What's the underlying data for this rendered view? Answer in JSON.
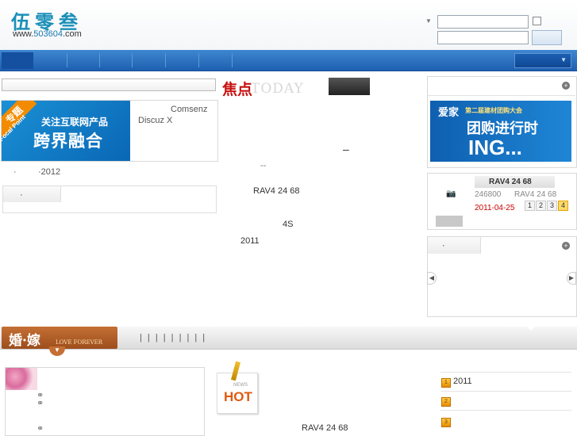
{
  "header": {
    "logo_text": "伍零叁",
    "logo_url_prefix": "www.",
    "logo_url_domain": "503604",
    "logo_url_suffix": ".com"
  },
  "focal": {
    "badge_top": "专题",
    "badge_sub": "Focal Point",
    "banner_line1": "关注互联网产品",
    "banner_line2": "跨界融合",
    "side_line1": "Comsenz",
    "side_line2": "Discuz X",
    "year_item": "2012"
  },
  "center": {
    "focus_title": "焦点",
    "focus_today": "TODAY",
    "dash1": "–",
    "dash2": "--",
    "line_rav4": "RAV4 24 68",
    "line_4s": "4S",
    "line_2011": "2011"
  },
  "group_buy": {
    "brand": "爱家",
    "event": "第二届建材团购大会",
    "line2": "团购进行时",
    "line3": "ING..."
  },
  "product": {
    "title": "RAV4 24 68",
    "code": "246800",
    "model": "RAV4 24 68",
    "date": "2011-04-25",
    "pages": [
      "1",
      "2",
      "3",
      "4"
    ]
  },
  "wedding": {
    "title": "婚·嫁",
    "subtitle": "LOVE FOREVER",
    "tabs_glyphs": "| | | | | | | | |"
  },
  "bottom": {
    "hot_label": "HOT",
    "news_label": "NEWS",
    "line_rav4": "RAV4 24 68",
    "rank_item1": "2011",
    "rank_icons": [
      "1",
      "2",
      "3"
    ]
  },
  "colors": {
    "nav_blue": "#1e5fb0",
    "logo_blue": "#1a8fb8",
    "focus_red": "#c81010",
    "date_red": "#cc0000",
    "wedding_brown": "#9d4e1c"
  }
}
